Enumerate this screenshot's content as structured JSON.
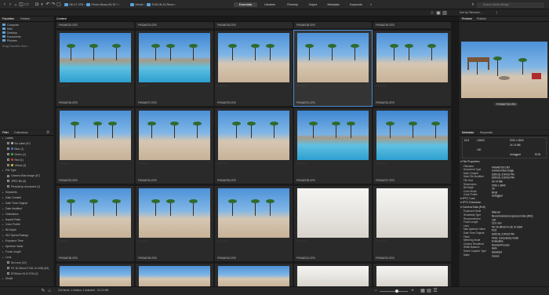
{
  "topbar": {
    "crumbs": [
      "HD-17 4TB",
      "Photo Library 06-15 +",
      "Airbnb",
      "2018-06-20-Remo"
    ],
    "workspaces": [
      "Essentials",
      "Libraries",
      "Filmstrip",
      "Output",
      "Metadata",
      "Keywords"
    ],
    "active_workspace": "Essentials",
    "search_placeholder": "Search Adobe Bridge"
  },
  "left": {
    "tabs": [
      "Favorites",
      "Folders"
    ],
    "favorites": [
      "Computer",
      "Kelli",
      "Desktop",
      "Documents",
      "Pictures"
    ],
    "drag_hint": "Drag Favorites Here...",
    "filter_tabs": [
      "Filter",
      "Collections"
    ],
    "filter_rows": [
      {
        "label": "Labels",
        "type": "header"
      },
      {
        "label": "No Label",
        "count": "(67)",
        "type": "dot",
        "color": "#bbbbbb"
      },
      {
        "label": "Blue",
        "count": "(1)",
        "type": "dot",
        "color": "#3c7fd8"
      },
      {
        "label": "Green",
        "count": "(1)",
        "type": "dot",
        "color": "#3fae3f"
      },
      {
        "label": "Red",
        "count": "(1)",
        "type": "dot",
        "color": "#d83c3c"
      },
      {
        "label": "Yellow",
        "count": "(3)",
        "type": "dot",
        "color": "#d8c23c"
      },
      {
        "label": "File Type",
        "type": "header"
      },
      {
        "label": "Camera Raw image",
        "count": "(67)",
        "type": "check"
      },
      {
        "label": "JPEG file",
        "count": "(6)",
        "type": "check"
      },
      {
        "label": "Photoshop document",
        "count": "(1)",
        "type": "check"
      },
      {
        "label": "Keywords",
        "type": "header"
      },
      {
        "label": "Date Created",
        "type": "header"
      },
      {
        "label": "Date Time Original",
        "type": "header"
      },
      {
        "label": "Date Modified",
        "type": "header"
      },
      {
        "label": "Orientation",
        "type": "header"
      },
      {
        "label": "Aspect Ratio",
        "type": "header"
      },
      {
        "label": "Color Profile",
        "type": "header"
      },
      {
        "label": "Bit Depth",
        "type": "header"
      },
      {
        "label": "ISO Speed Ratings",
        "type": "header"
      },
      {
        "label": "Exposure Time",
        "type": "header"
      },
      {
        "label": "Aperture Value",
        "type": "header"
      },
      {
        "label": "Focal Length",
        "type": "header"
      },
      {
        "label": "Lens",
        "type": "header"
      },
      {
        "label": "No Lens",
        "count": "(10)",
        "type": "check"
      },
      {
        "label": "FE 16-35mm F2.8L III USM",
        "count": "(62)",
        "type": "check"
      },
      {
        "label": "EF50mm f/1.8 STM",
        "count": "(2)",
        "type": "check"
      },
      {
        "label": "Model",
        "type": "header"
      }
    ]
  },
  "content": {
    "tab": "Content",
    "top_row_names": [
      "FHSA6720.CR3",
      "FHSA6723.CR3",
      "FHSA6725.CR3",
      "FHSA6728.CR3",
      "FHSA6730.CR3"
    ],
    "rows": [
      [
        "FHSA6726.CR3",
        "FHSA6727.CR3",
        "FHSA6729.CR3",
        "FHSA6731.CR3",
        "FHSA6732.CR3"
      ],
      [
        "FHSA6733.CR3",
        "FHSA6734.CR3",
        "FHSA6735.CR3",
        "FHSA6736.CR3",
        "FHSA6737.CR3"
      ],
      [
        "FHSA6738.CR3",
        "FHSA6739.CR3",
        "FHSA6740.CR3",
        "FHSA6741.CR3",
        "FHSA6742.CR3"
      ]
    ],
    "selected_index": 3
  },
  "right": {
    "tabs": [
      "Preview",
      "Publish"
    ],
    "preview_caption": "FHSA6730.CR3",
    "meta_tabs": [
      "Metadata",
      "Keywords"
    ],
    "summary": {
      "aperture": "f/4.5",
      "shutter": "1/3000",
      "dims": "5760 x 3840",
      "size": "24.74 MB",
      "iso": "100",
      "color": "RGB",
      "profile": "Untagged"
    },
    "sections": [
      {
        "title": "File Properties",
        "rows": [
          [
            "Filename",
            "FHSA6730.CR3"
          ],
          [
            "Document Type",
            "Camera Raw image"
          ],
          [
            "Date Created",
            "6/20/18, 3:54:03 PM"
          ],
          [
            "Date File Modified",
            "6/20/18, 3:54:03 PM"
          ],
          [
            "File Size",
            "24.74 MB"
          ],
          [
            "Dimensions",
            "5760 x 3840"
          ],
          [
            "Bit Depth",
            "16"
          ],
          [
            "Color Mode",
            "RGB"
          ],
          [
            "Color Profile",
            "Untagged"
          ]
        ]
      },
      {
        "title": "IPTC Core",
        "rows": []
      },
      {
        "title": "IPTC Extension",
        "rows": []
      },
      {
        "title": "Camera Data (Exif)",
        "rows": [
          [
            "Exposure Mode",
            "Manual"
          ],
          [
            "Sensitivity Type",
            "Recommended exposure index (REI)"
          ],
          [
            "Recommended",
            "100"
          ],
          [
            "Focal Length",
            "22.0 mm"
          ],
          [
            "Lens",
            "FE 16-35mm F2.8L III USM"
          ],
          [
            "Max Aperture Value",
            "f/2.8"
          ],
          [
            "Date Time Original",
            "6/20/18, 3:54:03 PM"
          ],
          [
            "Flash",
            "Fired, compulsory mode"
          ],
          [
            "Metering Mode",
            "Evaluative"
          ],
          [
            "Custom Rendered",
            "Normal Process"
          ],
          [
            "White Balance",
            "Auto"
          ],
          [
            "Scene Capture Type",
            "Standard"
          ],
          [
            "Make",
            "Canon"
          ]
        ]
      }
    ]
  },
  "bottom": {
    "status": "102 items, 1 hidden, 1 selected - 24.74 MB"
  }
}
